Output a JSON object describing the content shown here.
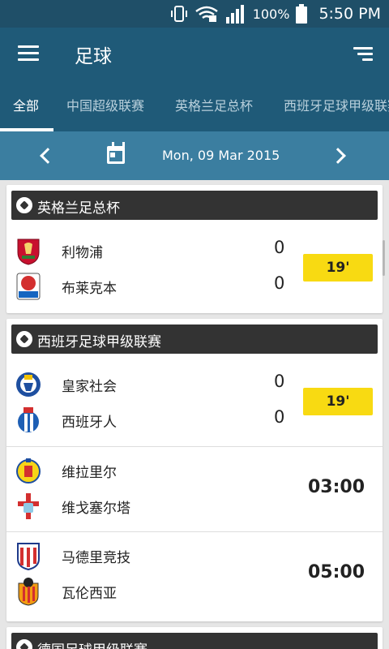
{
  "status": {
    "battery": "100%",
    "time": "5:50 PM"
  },
  "appbar": {
    "title": "足球"
  },
  "tabs": [
    {
      "label": "全部",
      "active": true
    },
    {
      "label": "中国超级联赛"
    },
    {
      "label": "英格兰足总杯"
    },
    {
      "label": "西班牙足球甲级联赛"
    }
  ],
  "datebar": {
    "date": "Mon, 09 Mar 2015"
  },
  "colors": {
    "appbar": "#1f5a78",
    "datebar": "#3b7ea0",
    "live": "#f8da12",
    "header": "#333333"
  },
  "leagues": [
    {
      "name": "英格兰足总杯",
      "matches": [
        {
          "home": "利物浦",
          "away": "布莱克本",
          "home_score": "0",
          "away_score": "0",
          "status": "19'"
        }
      ]
    },
    {
      "name": "西班牙足球甲级联赛",
      "matches": [
        {
          "home": "皇家社会",
          "away": "西班牙人",
          "home_score": "0",
          "away_score": "0",
          "status": "19'"
        },
        {
          "home": "维拉里尔",
          "away": "维戈塞尔塔",
          "kickoff": "03:00"
        },
        {
          "home": "马德里竞技",
          "away": "瓦伦西亚",
          "kickoff": "05:00"
        }
      ]
    },
    {
      "name": "德国足球甲级联赛"
    }
  ]
}
